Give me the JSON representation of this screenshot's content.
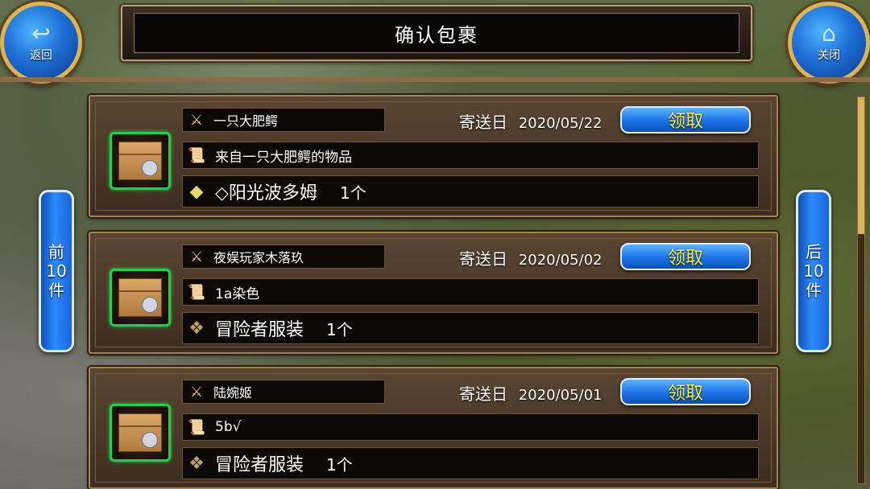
{
  "header": {
    "title": "确认包裹",
    "back": {
      "label": "返回",
      "icon": "back-arrow-icon"
    },
    "close": {
      "label": "关闭",
      "icon": "home-icon"
    }
  },
  "pager": {
    "prev_label": [
      "前",
      "10",
      "件"
    ],
    "next_label": [
      "后",
      "10",
      "件"
    ]
  },
  "parcels": [
    {
      "sender": "一只大肥鳄",
      "date_label": "寄送日",
      "date": "2020/05/22",
      "claim_label": "领取",
      "note": "来自一只大肥鳄的物品",
      "item_name": "◇阳光波多姆",
      "item_qty": "1个",
      "item_icon": "crystal-icon"
    },
    {
      "sender": "夜娱玩家木落玖",
      "date_label": "寄送日",
      "date": "2020/05/02",
      "claim_label": "领取",
      "note": "1a染色",
      "item_name": "冒险者服装",
      "item_qty": "1个",
      "item_icon": "clothing-icon"
    },
    {
      "sender": "陆婉姬",
      "date_label": "寄送日",
      "date": "2020/05/01",
      "claim_label": "领取",
      "note": "5b√",
      "item_name": "冒险者服装",
      "item_qty": "1个",
      "item_icon": "clothing-icon"
    }
  ]
}
